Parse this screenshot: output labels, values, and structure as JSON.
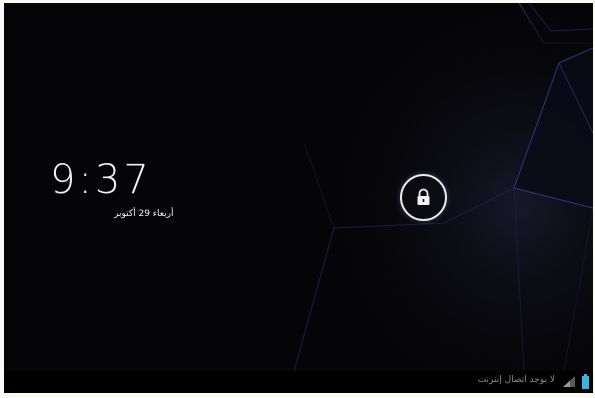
{
  "lockscreen": {
    "time": "9:37",
    "date": "أربعاء 29 أكتوبر",
    "unlock_handle_icon": "lock-icon"
  },
  "status_bar": {
    "connection_text": "لا يوجد اتصال إنترنت",
    "signal_icon": "signal-icon",
    "battery_icon": "battery-icon"
  },
  "colors": {
    "background": "#050507",
    "wallpaper_accent": "#4a4aa8",
    "text": "#f2f2f2",
    "status_text": "#8a8a8a",
    "battery": "#33b5e5"
  }
}
